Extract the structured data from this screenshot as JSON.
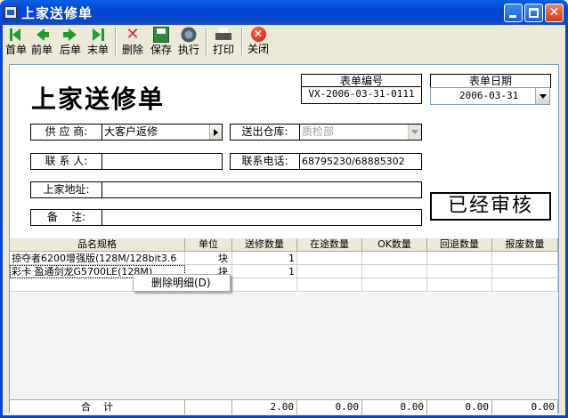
{
  "window": {
    "title": "上家送修单"
  },
  "toolbar": {
    "first": "首单",
    "prev": "前单",
    "next": "后单",
    "last": "末单",
    "delete": "删除",
    "save": "保存",
    "execute": "执行",
    "print": "打印",
    "close": "关闭"
  },
  "form": {
    "title": "上家送修单",
    "doc_no_label": "表单编号",
    "doc_no": "VX-2006-03-31-0111",
    "date_label": "表单日期",
    "date": "2006-03-31",
    "supplier_label": "供 应 商:",
    "supplier": "大客户返修",
    "warehouse_label": "送出仓库:",
    "warehouse": "质检部",
    "contact_label": "联 系 人:",
    "contact": "",
    "phone_label": "联系电话:",
    "phone": "68795230/68885302",
    "address_label": "上家地址:",
    "address": "",
    "remark_label": "备    注:",
    "remark": "",
    "status": "已经审核"
  },
  "grid": {
    "columns": [
      "品名规格",
      "单位",
      "送修数量",
      "在途数量",
      "OK数量",
      "回退数量",
      "报废数量"
    ],
    "rows": [
      {
        "name": "掠夺者6200增强版(128M/128bit3.6",
        "unit": "块",
        "qty": "1"
      },
      {
        "name": "彩卡 盈通剑龙G5700LE(128M)",
        "unit": "块",
        "qty": "1"
      }
    ],
    "totals": {
      "label": "合    计",
      "qty": "2.00",
      "in_transit": "0.00",
      "ok": "0.00",
      "returned": "0.00",
      "scrapped": "0.00"
    }
  },
  "context_menu": {
    "item": "删除明细(D)"
  }
}
